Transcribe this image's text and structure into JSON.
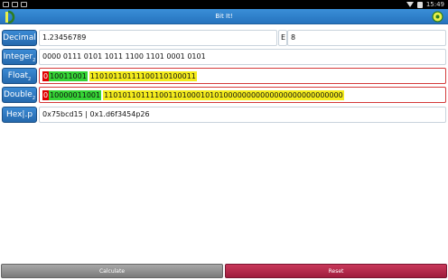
{
  "status_bar": {
    "time": "15:49"
  },
  "app": {
    "title": "Bit It!"
  },
  "rows": {
    "decimal": {
      "label": "Decimal",
      "value": "1.23456789",
      "exponent_label": "E",
      "exponent_value": "8"
    },
    "integer": {
      "label": "Integer",
      "sub": "2",
      "value": "0000 0111 0101 1011 1100 1101 0001 0101"
    },
    "float": {
      "label": "Float",
      "sub": "2",
      "sign": "0",
      "exponent": "10011001",
      "mantissa": "11010110111100110100011"
    },
    "double": {
      "label": "Double",
      "sub": "2",
      "sign": "0",
      "exponent": "10000011001",
      "mantissa": "1101011011110011010001010100000000000000000000000000"
    },
    "hex": {
      "label": "Hex|.p",
      "value": "0x75bcd15 |  0x1.d6f3454p26"
    }
  },
  "buttons": {
    "calculate": "Calculate",
    "reset": "Reset"
  },
  "colors": {
    "accent": "#2f7fcb",
    "sign": "#e00000",
    "exponent": "#35d435",
    "mantissa": "#f4ec1c",
    "reset": "#b02a4a",
    "calculate": "#8f8f8f"
  }
}
